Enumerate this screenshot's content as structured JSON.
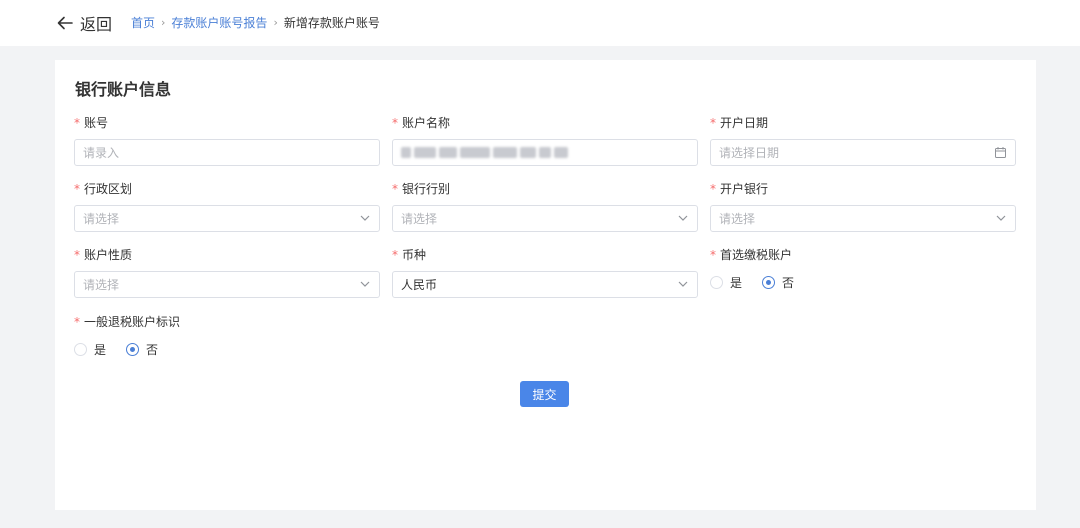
{
  "header": {
    "back_label": "返回",
    "breadcrumb": {
      "home": "首页",
      "parent": "存款账户账号报告",
      "current": "新增存款账户账号"
    }
  },
  "form": {
    "title": "银行账户信息",
    "required_mark": "*",
    "fields": {
      "account_number": {
        "label": "账号",
        "placeholder": "请录入",
        "value": ""
      },
      "account_name": {
        "label": "账户名称",
        "value": ""
      },
      "open_date": {
        "label": "开户日期",
        "placeholder": "请选择日期"
      },
      "admin_region": {
        "label": "行政区划",
        "placeholder": "请选择"
      },
      "bank_category": {
        "label": "银行行别",
        "placeholder": "请选择"
      },
      "opening_bank": {
        "label": "开户银行",
        "placeholder": "请选择"
      },
      "account_nature": {
        "label": "账户性质",
        "placeholder": "请选择"
      },
      "currency": {
        "label": "币种",
        "value": "人民币"
      },
      "preferred_tax_account": {
        "label": "首选缴税账户",
        "options": [
          "是",
          "否"
        ],
        "selected": "否"
      },
      "general_refund_flag": {
        "label": "一般退税账户标识",
        "options": [
          "是",
          "否"
        ],
        "selected": "否"
      }
    },
    "submit_label": "提交"
  },
  "colors": {
    "accent": "#4a7fd6",
    "button": "#4a86e8",
    "required": "#f56c6c",
    "page_bg": "#f2f3f5"
  }
}
